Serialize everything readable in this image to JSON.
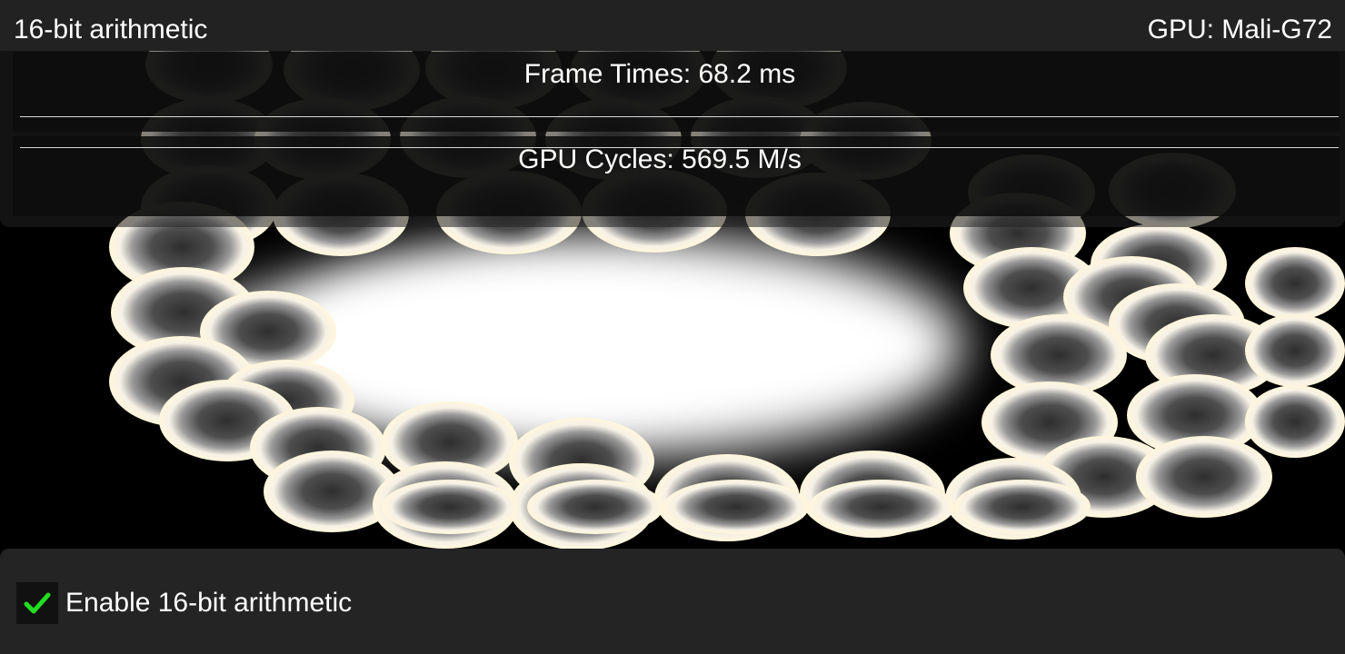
{
  "hud": {
    "title": "16-bit arithmetic",
    "gpu": "GPU: Mali-G72",
    "graphs": {
      "frame_times": "Frame Times: 68.2 ms",
      "gpu_cycles": "GPU Cycles: 569.5 M/s"
    }
  },
  "settings": {
    "fp16_toggle": {
      "label": "Enable 16-bit arithmetic",
      "checked": true
    }
  },
  "colors": {
    "check": "#22dd22",
    "panel": "#242424",
    "background": "#000000"
  },
  "icons": {
    "checkbox": "checkmark-icon"
  }
}
